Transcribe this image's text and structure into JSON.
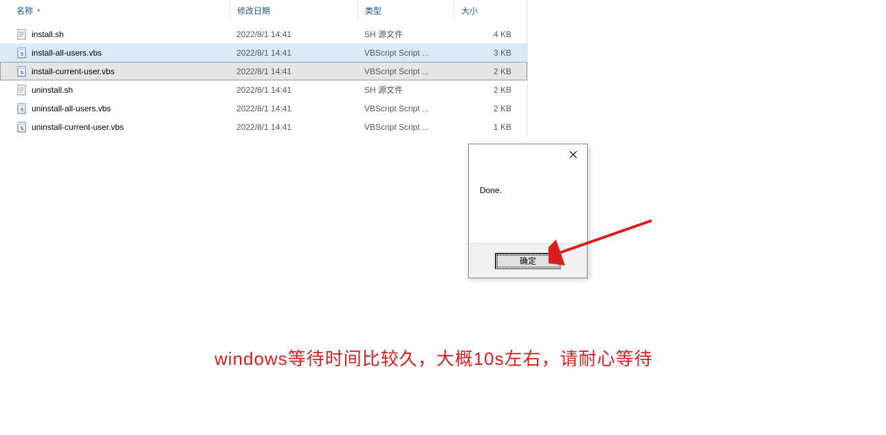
{
  "columns": {
    "name": "名称",
    "date": "修改日期",
    "type": "类型",
    "size": "大小"
  },
  "files": [
    {
      "icon": "sh",
      "name": "install.sh",
      "date": "2022/8/1 14:41",
      "type": "SH 源文件",
      "size": "4 KB",
      "state": ""
    },
    {
      "icon": "vbs",
      "name": "install-all-users.vbs",
      "date": "2022/8/1 14:41",
      "type": "VBScript Script ...",
      "size": "3 KB",
      "state": "selected"
    },
    {
      "icon": "vbs",
      "name": "install-current-user.vbs",
      "date": "2022/8/1 14:41",
      "type": "VBScript Script ...",
      "size": "2 KB",
      "state": "focused"
    },
    {
      "icon": "sh",
      "name": "uninstall.sh",
      "date": "2022/8/1 14:41",
      "type": "SH 源文件",
      "size": "2 KB",
      "state": ""
    },
    {
      "icon": "vbs",
      "name": "uninstall-all-users.vbs",
      "date": "2022/8/1 14:41",
      "type": "VBScript Script ...",
      "size": "2 KB",
      "state": ""
    },
    {
      "icon": "vbs",
      "name": "uninstall-current-user.vbs",
      "date": "2022/8/1 14:41",
      "type": "VBScript Script ...",
      "size": "1 KB",
      "state": ""
    }
  ],
  "dialog": {
    "message": "Done.",
    "ok_label": "确定"
  },
  "caption": "windows等待时间比较久，大概10s左右，请耐心等待"
}
